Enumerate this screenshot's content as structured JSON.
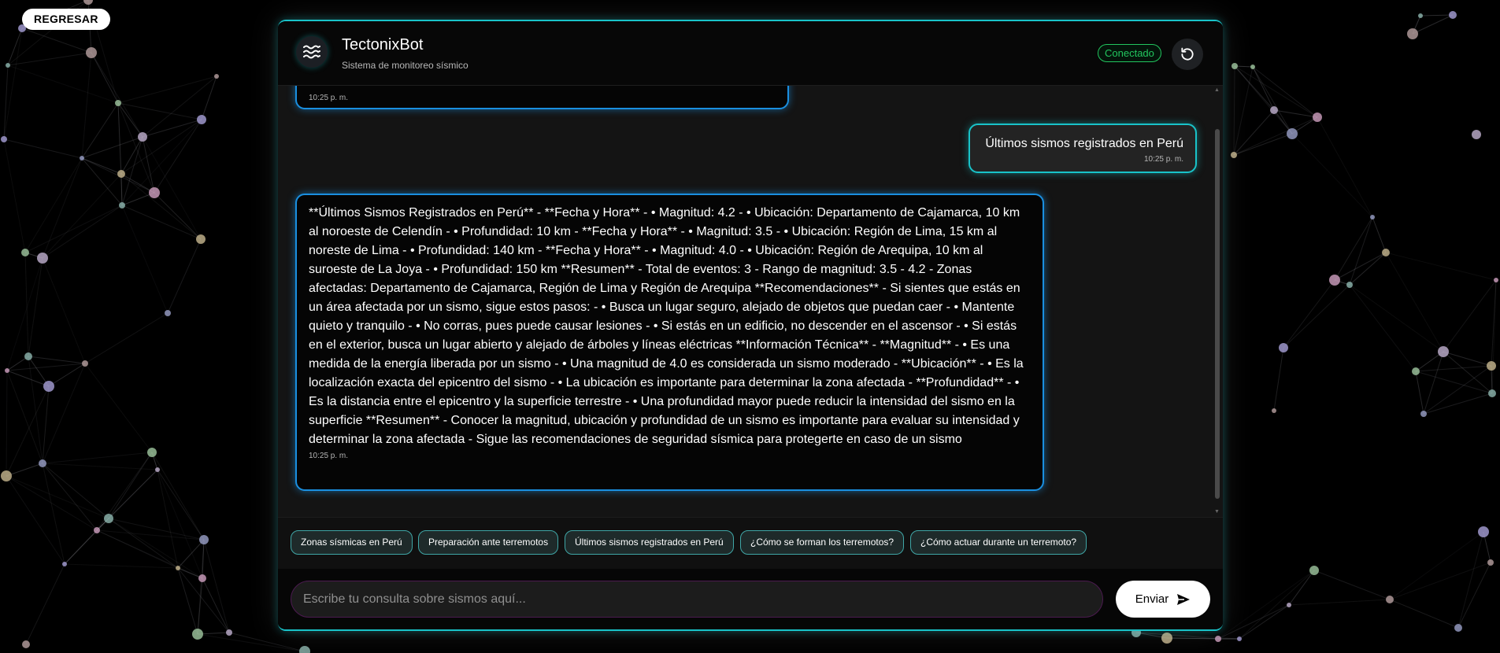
{
  "nav": {
    "back_label": "REGRESAR"
  },
  "header": {
    "bot_name": "TectonixBot",
    "subtitle": "Sistema de monitoreo sísmico",
    "status": "Conectado",
    "avatar_icon": "waves-icon",
    "reset_icon": "refresh-icon"
  },
  "messages": [
    {
      "role": "bot",
      "text": "",
      "time": "10:25 p. m."
    },
    {
      "role": "user",
      "text": "Últimos sismos registrados en Perú",
      "time": "10:25 p. m."
    },
    {
      "role": "bot",
      "text": "**Últimos Sismos Registrados en Perú** - **Fecha y Hora** - • Magnitud: 4.2 - • Ubicación: Departamento de Cajamarca, 10 km al noroeste de Celendín - • Profundidad: 10 km - **Fecha y Hora** - • Magnitud: 3.5 - • Ubicación: Región de Lima, 15 km al noreste de Lima - • Profundidad: 140 km - **Fecha y Hora** - • Magnitud: 4.0 - • Ubicación: Región de Arequipa, 10 km al suroeste de La Joya - • Profundidad: 150 km **Resumen** - Total de eventos: 3 - Rango de magnitud: 3.5 - 4.2 - Zonas afectadas: Departamento de Cajamarca, Región de Lima y Región de Arequipa **Recomendaciones** - Si sientes que estás en un área afectada por un sismo, sigue estos pasos: - • Busca un lugar seguro, alejado de objetos que puedan caer - • Mantente quieto y tranquilo - • No corras, pues puede causar lesiones - • Si estás en un edificio, no descender en el ascensor - • Si estás en el exterior, busca un lugar abierto y alejado de árboles y líneas eléctricas **Información Técnica** - **Magnitud** - • Es una medida de la energía liberada por un sismo - • Una magnitud de 4.0 es considerada un sismo moderado - **Ubicación** - • Es la localización exacta del epicentro del sismo - • La ubicación es importante para determinar la zona afectada - **Profundidad** - • Es la distancia entre el epicentro y la superficie terrestre - • Una profundidad mayor puede reducir la intensidad del sismo en la superficie **Resumen** - Conocer la magnitud, ubicación y profundidad de un sismo es importante para evaluar su intensidad y determinar la zona afectada - Sigue las recomendaciones de seguridad sísmica para protegerte en caso de un sismo",
      "time": "10:25 p. m."
    }
  ],
  "suggestions": [
    "Zonas sísmicas en Perú",
    "Preparación ante terremotos",
    "Últimos sismos registrados en Perú",
    "¿Cómo se forman los terremotos?",
    "¿Cómo actuar durante un terremoto?"
  ],
  "composer": {
    "placeholder": "Escribe tu consulta sobre sismos aquí...",
    "send_label": "Enviar",
    "send_icon": "send-icon"
  },
  "colors": {
    "accent_cyan": "#19c3c9",
    "bot_bubble_border": "#1a8fe0",
    "status_green": "#22c55e",
    "background": "#000000"
  }
}
